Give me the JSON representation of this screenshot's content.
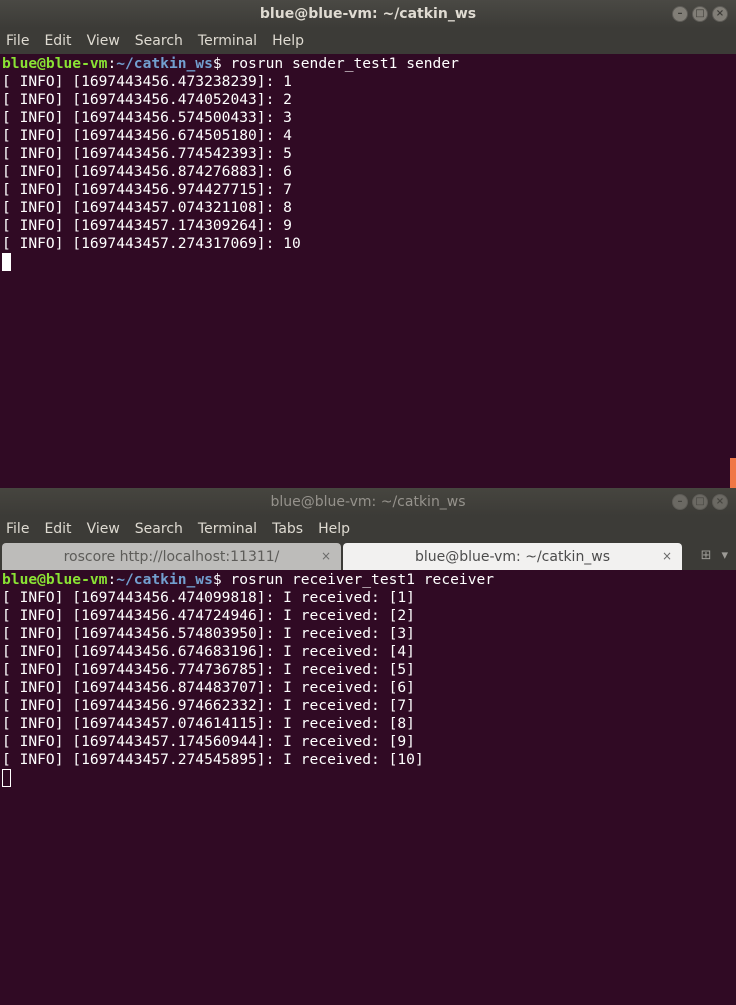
{
  "window1": {
    "title": "blue@blue-vm: ~/catkin_ws",
    "menu": [
      "File",
      "Edit",
      "View",
      "Search",
      "Terminal",
      "Help"
    ],
    "prompt": {
      "user": "blue@blue-vm",
      "path": "~/catkin_ws",
      "command": "rosrun sender_test1 sender"
    },
    "lines": [
      "[ INFO] [1697443456.473238239]: 1",
      "[ INFO] [1697443456.474052043]: 2",
      "[ INFO] [1697443456.574500433]: 3",
      "[ INFO] [1697443456.674505180]: 4",
      "[ INFO] [1697443456.774542393]: 5",
      "[ INFO] [1697443456.874276883]: 6",
      "[ INFO] [1697443456.974427715]: 7",
      "[ INFO] [1697443457.074321108]: 8",
      "[ INFO] [1697443457.174309264]: 9",
      "[ INFO] [1697443457.274317069]: 10"
    ]
  },
  "window2": {
    "title": "blue@blue-vm: ~/catkin_ws",
    "menu": [
      "File",
      "Edit",
      "View",
      "Search",
      "Terminal",
      "Tabs",
      "Help"
    ],
    "tabs": [
      {
        "label": "roscore http://localhost:11311/"
      },
      {
        "label": "blue@blue-vm: ~/catkin_ws"
      }
    ],
    "prompt": {
      "user": "blue@blue-vm",
      "path": "~/catkin_ws",
      "command": "rosrun receiver_test1 receiver"
    },
    "lines": [
      "[ INFO] [1697443456.474099818]: I received: [1]",
      "[ INFO] [1697443456.474724946]: I received: [2]",
      "[ INFO] [1697443456.574803950]: I received: [3]",
      "[ INFO] [1697443456.674683196]: I received: [4]",
      "[ INFO] [1697443456.774736785]: I received: [5]",
      "[ INFO] [1697443456.874483707]: I received: [6]",
      "[ INFO] [1697443456.974662332]: I received: [7]",
      "[ INFO] [1697443457.074614115]: I received: [8]",
      "[ INFO] [1697443457.174560944]: I received: [9]",
      "[ INFO] [1697443457.274545895]: I received: [10]"
    ]
  },
  "colors": {
    "background": "#300a24",
    "user": "#8ae234",
    "path": "#729fcf",
    "scroll": "#f07746"
  }
}
